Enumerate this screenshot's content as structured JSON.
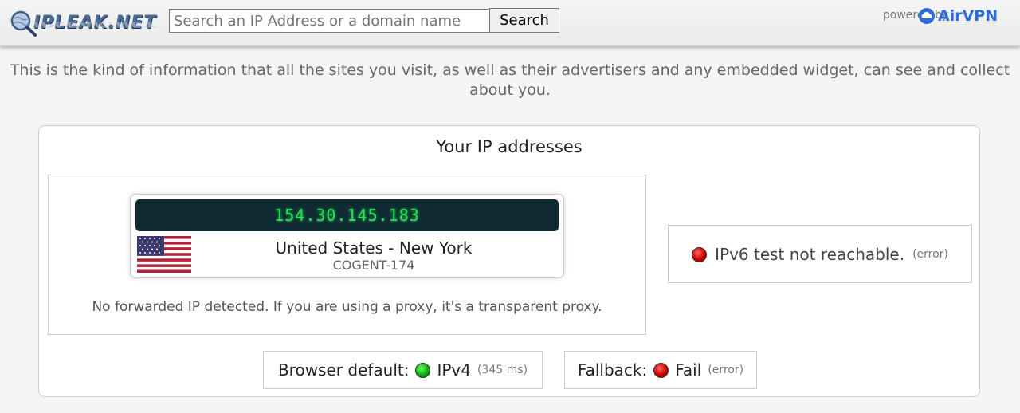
{
  "header": {
    "logo_text": "IPLEAK.NET",
    "search": {
      "placeholder": "Search an IP Address or a domain name",
      "button_label": "Search"
    },
    "powered_by_label": "powered by",
    "sponsor_name": "AirVPN"
  },
  "intro": "This is the kind of information that all the sites you visit, as well as their advertisers and any embedded widget, can see and collect about you.",
  "ip_section": {
    "title": "Your IP addresses",
    "ipv4": {
      "address": "154.30.145.183",
      "location": "United States - New York",
      "isp": "COGENT-174",
      "flag_icon": "us-flag-icon",
      "proxy_note": "No forwarded IP detected. If you are using a proxy, it's a transparent proxy."
    },
    "ipv6": {
      "status_icon": "red-status-icon",
      "message": "IPv6 test not reachable.",
      "detail": "(error)"
    },
    "browser_default": {
      "label": "Browser default:",
      "status_icon": "green-status-icon",
      "value": "IPv4",
      "detail": "(345 ms)"
    },
    "fallback": {
      "label": "Fallback:",
      "status_icon": "red-status-icon",
      "value": "Fail",
      "detail": "(error)"
    }
  },
  "colors": {
    "ip_display_bg": "#102a33",
    "ip_display_text": "#29e05a",
    "airvpn_blue": "#2b6ed9",
    "status_red": "#cc0000",
    "status_green": "#11aa11"
  }
}
